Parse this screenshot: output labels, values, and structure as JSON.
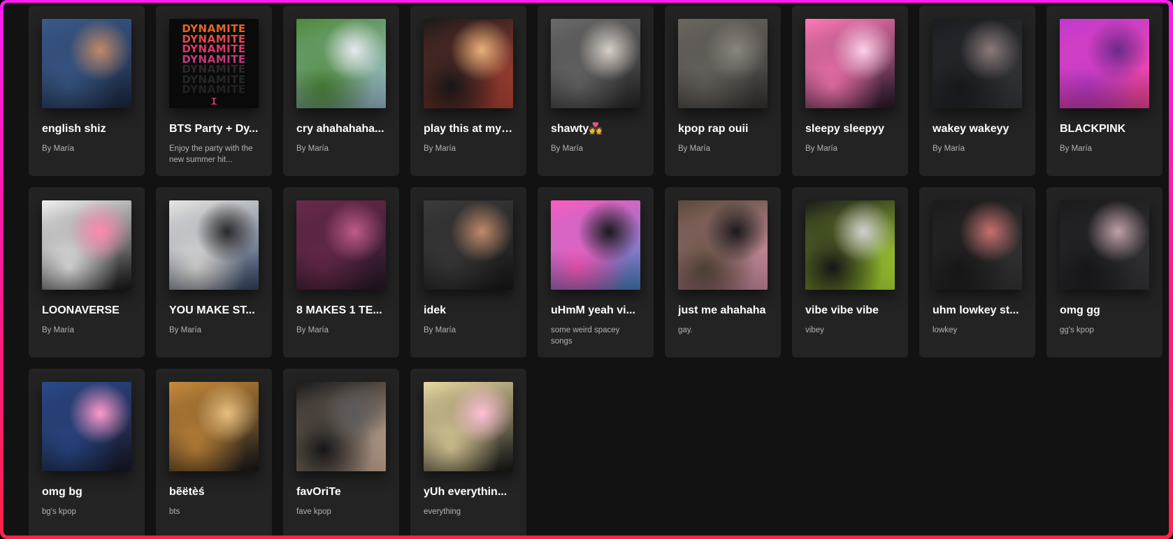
{
  "playlists": [
    {
      "title": "english shiz",
      "subtitle": "By María",
      "colors": [
        "#3a5a8a",
        "#1d2a44",
        "#c08a6a"
      ]
    },
    {
      "title": "BTS Party + Dy...",
      "subtitle": "Enjoy the party with the new summer hit...",
      "colors": [
        "#0a0a0a",
        "#1a1a1a",
        "#e03a6a"
      ],
      "cover_text": "DYNAMITE"
    },
    {
      "title": "cry ahahahaha...",
      "subtitle": "By María",
      "colors": [
        "#4e8a3a",
        "#a9c8e0",
        "#e6e9ee"
      ]
    },
    {
      "title": "play this at my ...",
      "subtitle": "By María",
      "colors": [
        "#1a1a1a",
        "#c94a3a",
        "#e8b07a"
      ]
    },
    {
      "title": "shawty💑",
      "subtitle": "By María",
      "colors": [
        "#6a6a6a",
        "#2a2a2a",
        "#d8d0c8"
      ]
    },
    {
      "title": "kpop rap ouii",
      "subtitle": "By María",
      "colors": [
        "#6a6660",
        "#3a3836",
        "#8a867e"
      ]
    },
    {
      "title": "sleepy sleepyy",
      "subtitle": "By María",
      "colors": [
        "#ff7ab8",
        "#2a1a2a",
        "#ffd0e6"
      ]
    },
    {
      "title": "wakey wakeyy",
      "subtitle": "By María",
      "colors": [
        "#1a1c20",
        "#3a3c40",
        "#8a7a7a"
      ]
    },
    {
      "title": "BLACKPINK",
      "subtitle": "By María",
      "colors": [
        "#c03ad0",
        "#ff4aa0",
        "#6a2a8a"
      ]
    },
    {
      "title": "LOONAVERSE",
      "subtitle": "By María",
      "colors": [
        "#f0f0f0",
        "#1a1a1a",
        "#ff8ab0"
      ]
    },
    {
      "title": "YOU MAKE ST...",
      "subtitle": "By María",
      "colors": [
        "#e8e6e2",
        "#3a4a6a",
        "#2a2a2a"
      ]
    },
    {
      "title": "8 MAKES 1 TE...",
      "subtitle": "By María",
      "colors": [
        "#6a2a4a",
        "#2a1a2a",
        "#c05a8a"
      ]
    },
    {
      "title": "idek",
      "subtitle": "By María",
      "colors": [
        "#3a3a3a",
        "#1a1a1a",
        "#c08a6a"
      ]
    },
    {
      "title": "uHmM yeah vi...",
      "subtitle": "some weird spacey songs",
      "colors": [
        "#ff5ac0",
        "#4a8ad0",
        "#1a1a1a"
      ]
    },
    {
      "title": "just me ahahaha",
      "subtitle": "gay.",
      "colors": [
        "#5a4a3a",
        "#e8a0b8",
        "#1a1a1a"
      ]
    },
    {
      "title": "vibe vibe vibe",
      "subtitle": "vibey",
      "colors": [
        "#1a1a1a",
        "#c8ff3a",
        "#d0d0d0"
      ]
    },
    {
      "title": "uhm lowkey st...",
      "subtitle": "lowkey",
      "colors": [
        "#1a1a1a",
        "#3a3a3a",
        "#c87070"
      ]
    },
    {
      "title": "omg gg",
      "subtitle": "gg's kpop",
      "colors": [
        "#1a1a1c",
        "#3a3a3e",
        "#c0a0a8"
      ]
    },
    {
      "title": "omg bg",
      "subtitle": "bg's kpop",
      "colors": [
        "#2a4a8a",
        "#1a1a2a",
        "#ff9ad0"
      ]
    },
    {
      "title": "bẽëtèś",
      "subtitle": "bts",
      "colors": [
        "#c88a3a",
        "#1a1a1a",
        "#e8c080"
      ]
    },
    {
      "title": "favOriTe",
      "subtitle": "fave kpop",
      "colors": [
        "#1a1a1a",
        "#e8c8b0",
        "#5a5a5a"
      ]
    },
    {
      "title": "yUh everythin...",
      "subtitle": "everything",
      "colors": [
        "#e8d8a0",
        "#1a1a1a",
        "#ffc0d8"
      ]
    }
  ]
}
